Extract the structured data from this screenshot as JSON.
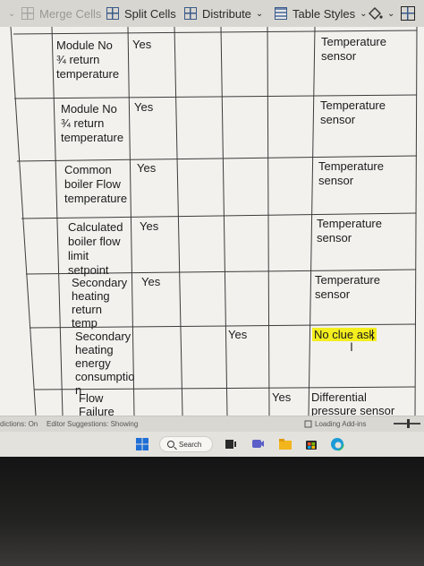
{
  "ribbon": {
    "merge_cells": "Merge Cells",
    "split_cells": "Split Cells",
    "distribute": "Distribute",
    "table_styles": "Table Styles"
  },
  "table": {
    "rows": [
      {
        "name": "Module No\n¾ return\ntemperature",
        "col2": "Yes",
        "col3": "",
        "col4": "",
        "col5": "",
        "col6": "Temperature\nsensor"
      },
      {
        "name": "Module No\n¾ return\ntemperature",
        "col2": "Yes",
        "col3": "",
        "col4": "",
        "col5": "",
        "col6": "Temperature\nsensor"
      },
      {
        "name": "Common\nboiler Flow\ntemperature",
        "col2": "Yes",
        "col3": "",
        "col4": "",
        "col5": "",
        "col6": "Temperature\nsensor"
      },
      {
        "name": "Calculated\nboiler flow\nlimit\nsetpoint",
        "col2": "Yes",
        "col3": "",
        "col4": "",
        "col5": "",
        "col6": "Temperature\nsensor"
      },
      {
        "name": "Secondary\nheating\nreturn\ntemp",
        "col2": "Yes",
        "col3": "",
        "col4": "",
        "col5": "",
        "col6": "Temperature\nsensor"
      },
      {
        "name": "Secondary\nheating\nenergy\nconsumptio\nn",
        "col2": "",
        "col3": "",
        "col4": "Yes",
        "col5": "",
        "col6": "No clue ask"
      },
      {
        "name": "Flow\nFailure",
        "col2": "",
        "col3": "",
        "col4": "",
        "col5": "Yes",
        "col6": "Differential\npressure sensor"
      }
    ]
  },
  "status": {
    "left": "dictions: On",
    "editor": "Editor Suggestions: Showing",
    "addins": "Loading Add-ins"
  },
  "taskbar": {
    "search_label": "Search"
  },
  "colors": {
    "highlight": "#f4ee1e",
    "accent": "#3a5a8a"
  }
}
